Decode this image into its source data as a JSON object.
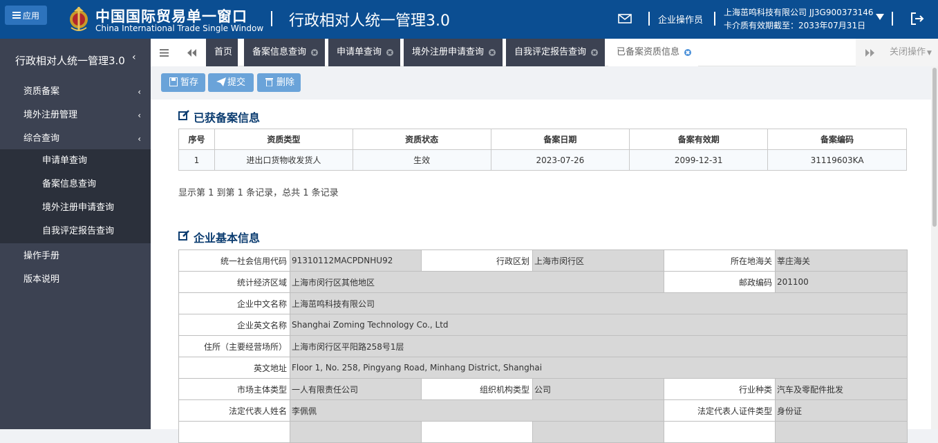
{
  "header": {
    "app_button": "应用",
    "brand_cn": "中国国际贸易单一窗口",
    "brand_en": "China International Trade Single Window",
    "system_title": "行政相对人统一管理3.0",
    "operator": "企业操作员",
    "company": "上海茁鸣科技有限公司 JJ3G900373146",
    "card_expiry": "卡介质有效期截至：2033年07月31日"
  },
  "sidebar": {
    "title": "行政相对人统一管理3.0",
    "items": [
      {
        "label": "资质备案"
      },
      {
        "label": "境外注册管理"
      },
      {
        "label": "综合查询"
      },
      {
        "label": "操作手册"
      },
      {
        "label": "版本说明"
      }
    ],
    "subitems": [
      {
        "label": "申请单查询"
      },
      {
        "label": "备案信息查询"
      },
      {
        "label": "境外注册申请查询"
      },
      {
        "label": "自我评定报告查询"
      }
    ]
  },
  "tabs": [
    {
      "label": "首页"
    },
    {
      "label": "备案信息查询"
    },
    {
      "label": "申请单查询"
    },
    {
      "label": "境外注册申请查询"
    },
    {
      "label": "自我评定报告查询"
    },
    {
      "label": "已备案资质信息"
    }
  ],
  "close_ops": "关闭操作",
  "toolbar": {
    "save": "暂存",
    "submit": "提交",
    "delete": "删除"
  },
  "section1": {
    "title": "已获备案信息",
    "columns": [
      "序号",
      "资质类型",
      "资质状态",
      "备案日期",
      "备案有效期",
      "备案编码"
    ],
    "rows": [
      [
        "1",
        "进出口货物收发货人",
        "生效",
        "2023-07-26",
        "2099-12-31",
        "31119603KA"
      ]
    ],
    "pager": "显示第 1 到第 1 条记录，总共 1 条记录"
  },
  "section2": {
    "title": "企业基本信息",
    "fields": {
      "uscc_label": "统一社会信用代码",
      "uscc": "91310112MACPDNHU92",
      "region_label": "行政区划",
      "region": "上海市闵行区",
      "customs_label": "所在地海关",
      "customs": "莘庄海关",
      "econ_label": "统计经济区域",
      "econ": "上海市闵行区其他地区",
      "zip_label": "邮政编码",
      "zip": "201100",
      "name_cn_label": "企业中文名称",
      "name_cn": "上海茁鸣科技有限公司",
      "name_en_label": "企业英文名称",
      "name_en": "Shanghai Zoming Technology Co., Ltd",
      "address_label": "住所（主要经营场所）",
      "address": "上海市闵行区平阳路258号1层",
      "address_en_label": "英文地址",
      "address_en": "Floor 1, No. 258, Pingyang Road, Minhang District, Shanghai",
      "entity_type_label": "市场主体类型",
      "entity_type": "一人有限责任公司",
      "org_type_label": "组织机构类型",
      "org_type": "公司",
      "industry_label": "行业种类",
      "industry": "汽车及零配件批发",
      "rep_name_label": "法定代表人姓名",
      "rep_name": "李佩佩",
      "rep_id_type_label": "法定代表人证件类型",
      "rep_id_type": "身份证"
    }
  }
}
